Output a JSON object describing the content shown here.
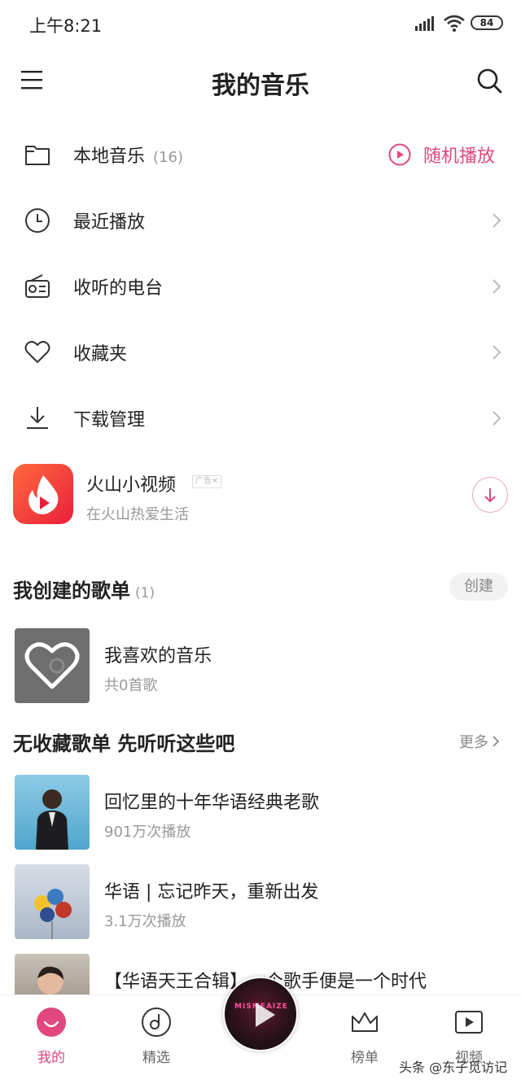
{
  "status": {
    "time": "上午8:21",
    "battery": "84"
  },
  "header": {
    "title": "我的音乐"
  },
  "menu": {
    "items": [
      {
        "label": "本地音乐",
        "count": "(16)",
        "icon": "folder-icon"
      },
      {
        "label": "最近播放",
        "icon": "clock-icon"
      },
      {
        "label": "收听的电台",
        "icon": "radio-icon"
      },
      {
        "label": "收藏夹",
        "icon": "heart-icon"
      },
      {
        "label": "下载管理",
        "icon": "download-icon"
      }
    ],
    "shuffle_label": "随机播放"
  },
  "ad": {
    "title": "火山小视频",
    "tag": "广告✕",
    "subtitle": "在火山热爱生活"
  },
  "created": {
    "title": "我创建的歌单",
    "count": "(1)",
    "create_label": "创建",
    "items": [
      {
        "title": "我喜欢的音乐",
        "sub": "共0首歌"
      }
    ]
  },
  "recommend": {
    "title": "无收藏歌单  先听听这些吧",
    "more_label": "更多",
    "items": [
      {
        "title": "回忆里的十年华语经典老歌",
        "sub": "901万次播放"
      },
      {
        "title": "华语 | 忘记昨天，重新出发",
        "sub": "3.1万次播放"
      },
      {
        "title": "【华语天王合辑】一个歌手便是一个时代",
        "sub": ""
      }
    ]
  },
  "tabs": [
    {
      "label": "我的",
      "icon": "smile-icon",
      "active": true
    },
    {
      "label": "精选",
      "icon": "disc-icon"
    },
    {
      "label": "榜单",
      "icon": "crown-icon"
    },
    {
      "label": "视频",
      "icon": "video-icon"
    }
  ],
  "player": {
    "art_text": "MISMEAIZE"
  },
  "watermark": "头条 @东子觅访记",
  "colors": {
    "accent": "#e0487e",
    "ad_red": "#e91f3a"
  }
}
